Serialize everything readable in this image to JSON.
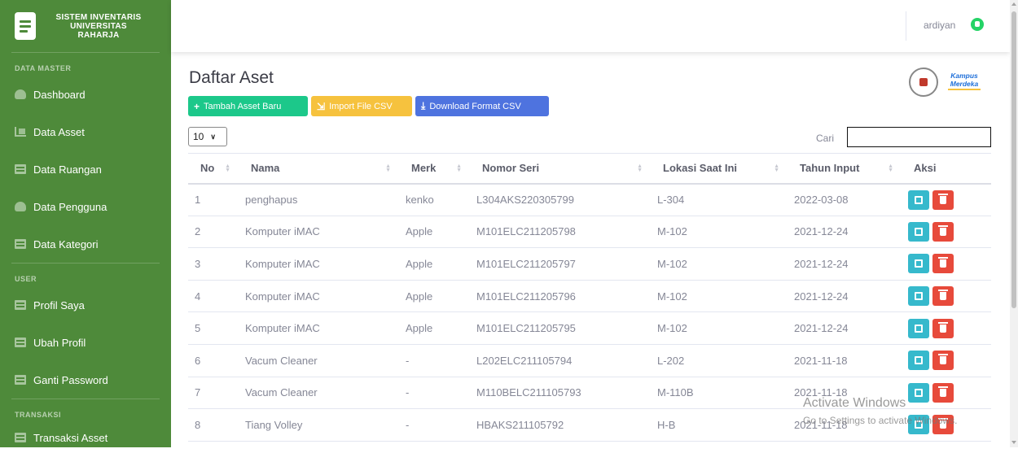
{
  "sidebar": {
    "brand": {
      "line1": "SISTEM INVENTARIS",
      "line2": "UNIVERSITAS",
      "line3": "RAHARJA"
    },
    "sections": [
      {
        "heading": "DATA MASTER",
        "items": [
          {
            "label": "Dashboard",
            "icon": "gauge-icon"
          },
          {
            "label": "Data Asset",
            "icon": "chart-icon"
          },
          {
            "label": "Data Ruangan",
            "icon": "file-icon"
          },
          {
            "label": "Data Pengguna",
            "icon": "gauge-icon"
          },
          {
            "label": "Data Kategori",
            "icon": "file-icon"
          }
        ]
      },
      {
        "heading": "USER",
        "items": [
          {
            "label": "Profil Saya",
            "icon": "file-icon"
          },
          {
            "label": "Ubah Profil",
            "icon": "file-icon"
          },
          {
            "label": "Ganti Password",
            "icon": "file-icon"
          }
        ]
      },
      {
        "heading": "TRANSAKSI",
        "items": [
          {
            "label": "Transaksi Asset",
            "icon": "file-icon"
          }
        ]
      }
    ]
  },
  "topbar": {
    "username": "ardiyan",
    "icon": "whatsapp-icon"
  },
  "main": {
    "title": "Daftar Aset",
    "buttons": {
      "add": "Tambah Asset Baru",
      "import": "Import File CSV",
      "download": "Download Format CSV"
    },
    "page_length": "10",
    "search_label": "Cari",
    "search_value": "",
    "columns": [
      "No",
      "Nama",
      "Merk",
      "Nomor Seri",
      "Lokasi Saat Ini",
      "Tahun Input",
      "Aksi"
    ],
    "rows": [
      [
        "1",
        "penghapus",
        "kenko",
        "L304AKS220305799",
        "L-304",
        "2022-03-08"
      ],
      [
        "2",
        "Komputer iMAC",
        "Apple",
        "M101ELC211205798",
        "M-102",
        "2021-12-24"
      ],
      [
        "3",
        "Komputer iMAC",
        "Apple",
        "M101ELC211205797",
        "M-102",
        "2021-12-24"
      ],
      [
        "4",
        "Komputer iMAC",
        "Apple",
        "M101ELC211205796",
        "M-102",
        "2021-12-24"
      ],
      [
        "5",
        "Komputer iMAC",
        "Apple",
        "M101ELC211205795",
        "M-102",
        "2021-12-24"
      ],
      [
        "6",
        "Vacum Cleaner",
        "-",
        "L202ELC211105794",
        "L-202",
        "2021-11-18"
      ],
      [
        "7",
        "Vacum Cleaner",
        "-",
        "M110BELC211105793",
        "M-110B",
        "2021-11-18"
      ],
      [
        "8",
        "Tiang Volley",
        "-",
        "HBAKS211105792",
        "H-B",
        "2021-11-18"
      ]
    ]
  },
  "watermark": {
    "line1": "Activate Windows",
    "line2": "Go to Settings to activate Windows."
  },
  "colors": {
    "sidebar": "#4e8a3a",
    "success": "#1cc88a",
    "warning": "#f6c23e",
    "primary": "#4e73df",
    "info": "#36b9cc",
    "danger": "#e74a3b"
  }
}
